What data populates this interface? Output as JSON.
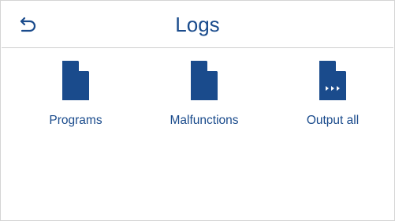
{
  "header": {
    "title": "Logs",
    "back_icon": "back-arrow-icon"
  },
  "tiles": [
    {
      "label": "Programs",
      "icon": "document-icon"
    },
    {
      "label": "Malfunctions",
      "icon": "document-icon"
    },
    {
      "label": "Output all",
      "icon": "document-output-icon"
    }
  ],
  "colors": {
    "accent": "#1a4b8c",
    "border": "#d4d4d4",
    "background": "#ffffff"
  }
}
